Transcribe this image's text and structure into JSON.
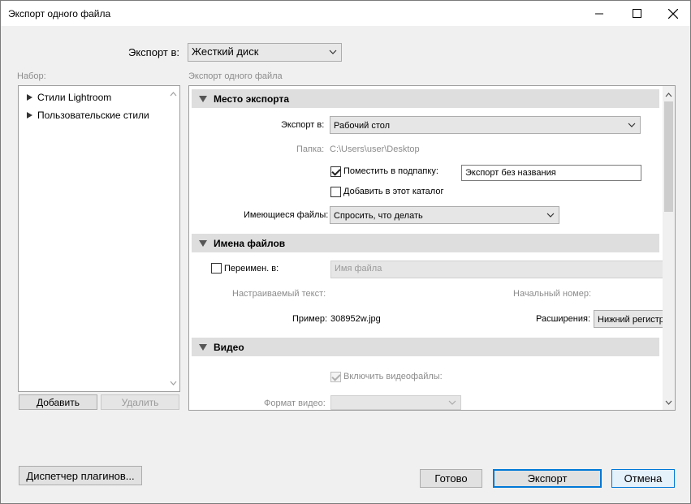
{
  "window": {
    "title": "Экспорт одного файла"
  },
  "export_to": {
    "label": "Экспорт в:",
    "value": "Жесткий диск"
  },
  "preset": {
    "label": "Набор:",
    "items": [
      {
        "label": "Стили Lightroom"
      },
      {
        "label": "Пользовательские стили"
      }
    ],
    "add_label": "Добавить",
    "remove_label": "Удалить"
  },
  "settings": {
    "caption": "Экспорт одного файла",
    "location": {
      "header": "Место экспорта",
      "export_to_label": "Экспорт в:",
      "export_to_value": "Рабочий стол",
      "folder_label": "Папка:",
      "folder_value": "C:\\Users\\user\\Desktop",
      "subfolder_label": "Поместить в подпапку:",
      "subfolder_checked": true,
      "subfolder_value": "Экспорт без названия",
      "add_catalog_label": "Добавить в этот каталог",
      "add_catalog_checked": false,
      "existing_label": "Имеющиеся файлы:",
      "existing_value": "Спросить, что делать"
    },
    "naming": {
      "header": "Имена файлов",
      "rename_label": "Переимен. в:",
      "rename_checked": false,
      "rename_value": "Имя файла",
      "custom_text_label": "Настраиваемый текст:",
      "start_number_label": "Начальный номер:",
      "example_label": "Пример:",
      "example_value": "308952w.jpg",
      "extensions_label": "Расширения:",
      "extensions_value": "Нижний регистр"
    },
    "video": {
      "header": "Видео",
      "include_label": "Включить видеофайлы:",
      "include_checked": true,
      "format_label": "Формат видео:",
      "format_value": ""
    }
  },
  "footer": {
    "plugin_manager_label": "Диспетчер плагинов...",
    "done_label": "Готово",
    "export_label": "Экспорт",
    "cancel_label": "Отмена"
  },
  "colors": {
    "accent": "#0078d7"
  }
}
